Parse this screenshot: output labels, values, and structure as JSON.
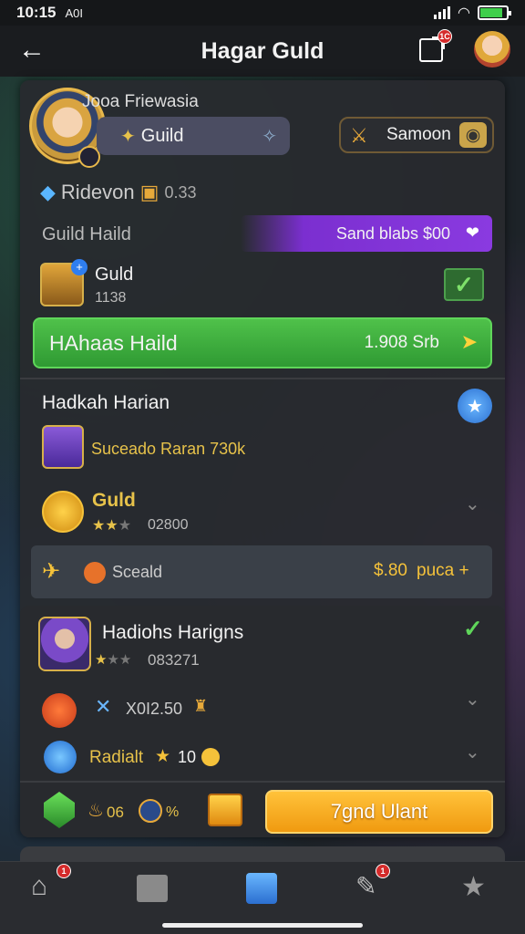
{
  "status": {
    "time": "10:15",
    "carrier": "A0I"
  },
  "header": {
    "title": "Hagar Guld",
    "notif_badge": "1C"
  },
  "profile": {
    "name": "Jooa Friewasia",
    "guild_tag": "Guild",
    "search_label": "Samoon"
  },
  "ridevon": {
    "label": "Ridevon",
    "value": "0.33"
  },
  "guild_hall": {
    "label": "Guild Haild",
    "promo": "Sand blabs $00"
  },
  "guild_item": {
    "name": "Guld",
    "value": "1138"
  },
  "green_button": {
    "label": "HAhaas Haild",
    "value": "1.908 Srb"
  },
  "section": {
    "title": "Hadkah Harian",
    "reward": "Suceado Raran 730k"
  },
  "gold_item": {
    "name": "Guld",
    "value": "02800"
  },
  "bar": {
    "label": "Sceald",
    "price": "$.80",
    "price_suffix": "puca +"
  },
  "card2": {
    "title": "Hadiohs Harigns",
    "value": "083271",
    "stat": "X0I2.50",
    "radiant": "Radialt",
    "radiant_value": "10",
    "bottom_val1": "06",
    "bottom_val2": "%",
    "button": "7gnd Ulant"
  },
  "tabbar": {
    "badges": [
      "1",
      "1"
    ]
  },
  "colors": {
    "green": "#3aa83c",
    "purple": "#7b2fd0",
    "orange": "#f4a51c",
    "gold": "#e7c24a"
  }
}
